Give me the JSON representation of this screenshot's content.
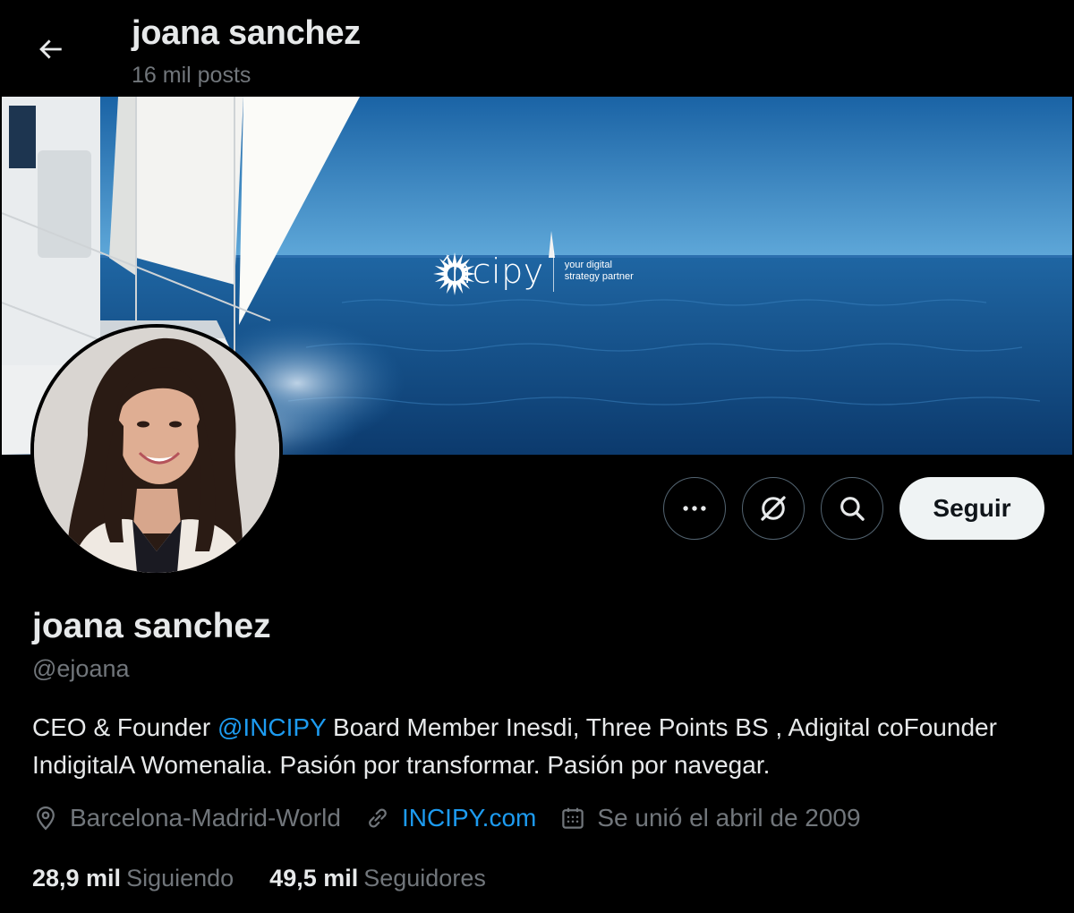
{
  "header": {
    "name": "joana sanchez",
    "posts": "16 mil posts",
    "back_icon": "arrow-left-icon"
  },
  "banner": {
    "brand_name": "íncipy",
    "brand_tagline": "your digital strategy partner"
  },
  "actions": {
    "more_icon": "more-dots-icon",
    "grok_icon": "grok-icon",
    "search_icon": "search-icon",
    "follow_label": "Seguir"
  },
  "profile": {
    "display_name": "joana sanchez",
    "handle": "@ejoana",
    "bio_part1": "CEO & Founder ",
    "bio_mention": "@INCIPY",
    "bio_part2": " Board Member Inesdi, Three Points BS , Adigital coFounder IndigitalA Womenalia. Pasión por transformar. Pasión por navegar.",
    "location": "Barcelona-Madrid-World",
    "website": "INCIPY.com",
    "joined": "Se unió el abril de 2009"
  },
  "stats": {
    "following_count": "28,9 mil",
    "following_label": "Siguiendo",
    "followers_count": "49,5 mil",
    "followers_label": "Seguidores"
  },
  "colors": {
    "background": "#000000",
    "text_primary": "#e7e9ea",
    "text_secondary": "#71767b",
    "link": "#1d9bf0",
    "follow_button_bg": "#eff3f4"
  }
}
